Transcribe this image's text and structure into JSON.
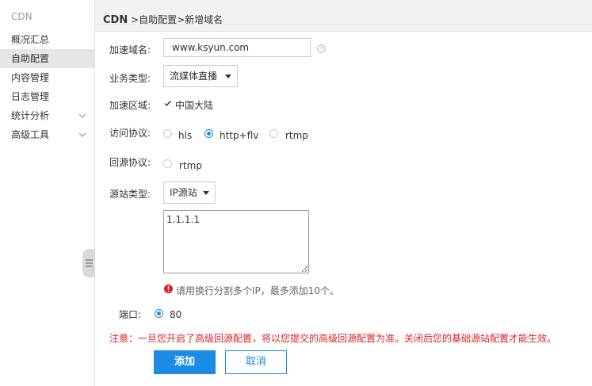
{
  "sidebar": {
    "title": "CDN",
    "items": [
      {
        "label": "概况汇总"
      },
      {
        "label": "自助配置"
      },
      {
        "label": "内容管理"
      },
      {
        "label": "日志管理"
      },
      {
        "label": "统计分析"
      },
      {
        "label": "高级工具"
      }
    ]
  },
  "breadcrumb": {
    "root": "CDN",
    "trail": " >自助配置>新增域名"
  },
  "form": {
    "domain": {
      "label": "加速域名:",
      "value": "www.ksyun.com"
    },
    "biz_type": {
      "label": "业务类型:",
      "value": "流媒体直播"
    },
    "region": {
      "label": "加速区域:",
      "option": "中国大陆"
    },
    "protocol": {
      "label": "访问协议:",
      "options": [
        "hls",
        "http+flv",
        "rtmp"
      ],
      "selected": "http+flv"
    },
    "origin_protocol": {
      "label": "回源协议:",
      "options": [
        "rtmp"
      ]
    },
    "origin_type": {
      "label": "源站类型:",
      "value": "IP源站",
      "ips": "1.1.1.1"
    },
    "hint": "请用换行分割多个IP，最多添加10个。",
    "port": {
      "label": "端口:",
      "value": "80"
    },
    "notice": "注意：一旦您开启了高级回源配置，将以您提交的高级回源配置为准。关闭后您的基础源站配置才能生效。",
    "submit_label": "添加",
    "cancel_label": "取消"
  },
  "colors": {
    "accent": "#1b8be3",
    "warning": "#e02020",
    "header_bg": "#f2f2f2",
    "active_bg": "#e6e6e6"
  }
}
